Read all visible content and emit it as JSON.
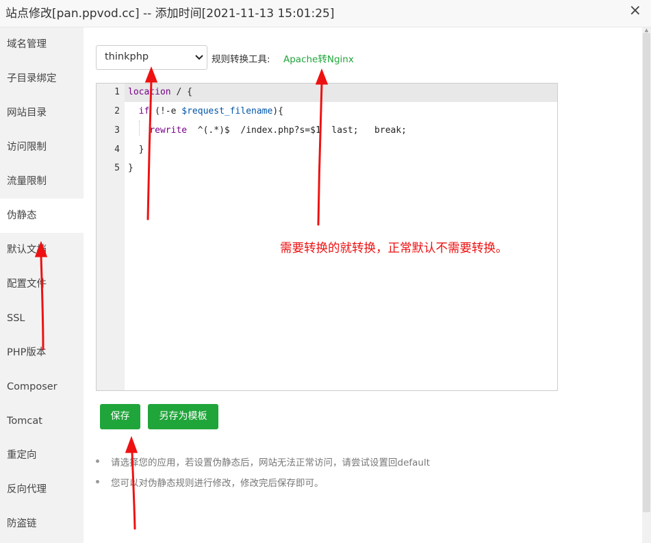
{
  "window": {
    "title": "站点修改[pan.ppvod.cc] -- 添加时间[2021-11-13 15:01:25]",
    "close_icon": "×"
  },
  "sidebar": {
    "items": [
      {
        "label": "域名管理"
      },
      {
        "label": "子目录绑定"
      },
      {
        "label": "网站目录"
      },
      {
        "label": "访问限制"
      },
      {
        "label": "流量限制"
      },
      {
        "label": "伪静态",
        "active": true
      },
      {
        "label": "默认文档"
      },
      {
        "label": "配置文件"
      },
      {
        "label": "SSL"
      },
      {
        "label": "PHP版本"
      },
      {
        "label": "Composer"
      },
      {
        "label": "Tomcat"
      },
      {
        "label": "重定向"
      },
      {
        "label": "反向代理"
      },
      {
        "label": "防盗链"
      }
    ]
  },
  "toolbar": {
    "template_select_value": "thinkphp",
    "tool_label": "规则转换工具:",
    "tool_link": "Apache转Nginx"
  },
  "editor": {
    "line_numbers": [
      "1",
      "2",
      "3",
      "4",
      "5"
    ],
    "lines": [
      "location / {",
      "  if (!-e $request_filename){",
      "    rewrite  ^(.*)$  /index.php?s=$1  last;   break;",
      "  }",
      "}"
    ]
  },
  "buttons": {
    "save_label": "保存",
    "save_as_template_label": "另存为模板"
  },
  "tips": [
    "请选择您的应用，若设置伪静态后，网站无法正常访问，请尝试设置回default",
    "您可以对伪静态规则进行修改，修改完后保存即可。"
  ],
  "annotation": {
    "text": "需要转换的就转换，正常默认不需要转换。",
    "color": "#ee1111"
  },
  "colors": {
    "accent": "#20a53a",
    "annotation": "#ee1111"
  }
}
